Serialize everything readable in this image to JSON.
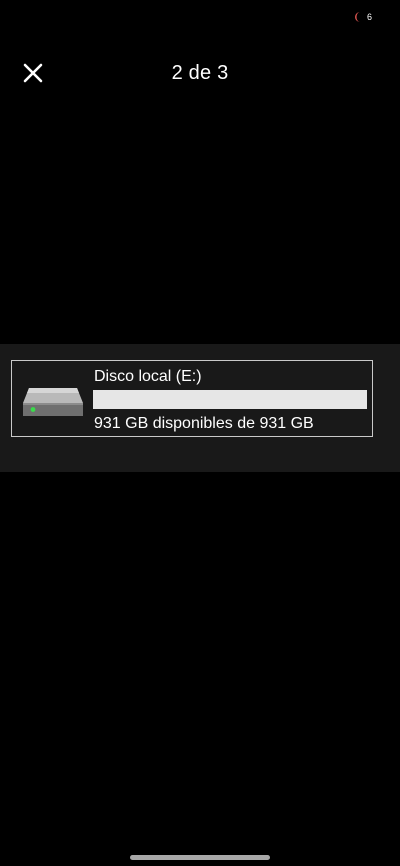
{
  "status_bar": {
    "notification_count": "6",
    "icon": "moon-icon"
  },
  "viewer": {
    "close_icon": "close-icon",
    "counter": "2 de 3"
  },
  "drive": {
    "icon": "hard-drive-icon",
    "name": "Disco local (E:)",
    "space_text": "931 GB disponibles de 931 GB",
    "used_fraction": 0.0
  },
  "colors": {
    "background": "#000000",
    "strip_background": "#191919",
    "tile_border": "#c9c9c9",
    "progress_track": "#e6e6e6",
    "moon_icon": "#d9534f"
  }
}
